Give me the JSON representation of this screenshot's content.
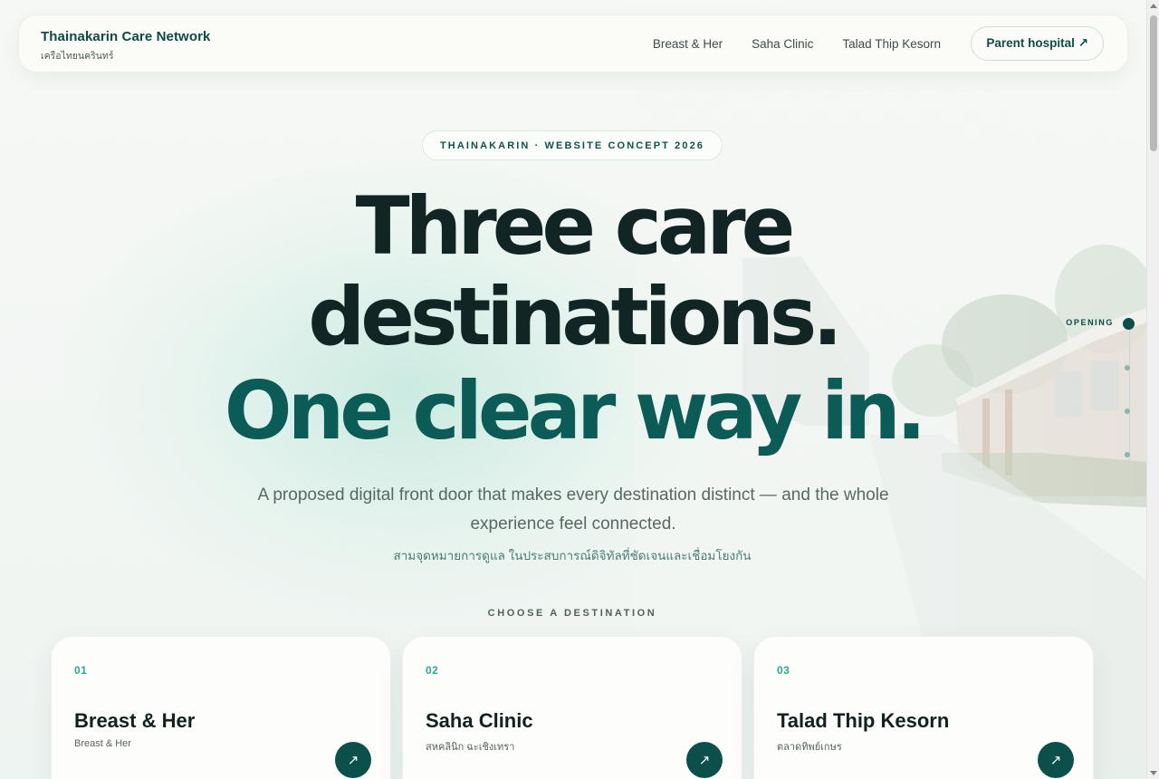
{
  "header": {
    "brand_name": "Thainakarin Care Network",
    "brand_sub": "เครือไทยนครินทร์",
    "nav": [
      {
        "label": "Breast & Her"
      },
      {
        "label": "Saha Clinic"
      },
      {
        "label": "Talad Thip Kesorn"
      }
    ],
    "parent_button": "Parent hospital ↗"
  },
  "hero": {
    "badge": "THAINAKARIN · WEBSITE CONCEPT 2026",
    "headline_line1": "Three care",
    "headline_line2": "destinations.",
    "headline_accent": "One clear way in.",
    "subtitle": "A proposed digital front door that makes every destination distinct — and the whole experience feel connected.",
    "subtitle_th": "สามจุดหมายการดูแล ในประสบการณ์ดิจิทัลที่ชัดเจนและเชื่อมโยงกัน",
    "choose_label": "CHOOSE A DESTINATION"
  },
  "cards": [
    {
      "num": "01",
      "title": "Breast & Her",
      "sub": "Breast & Her",
      "arrow": "↗"
    },
    {
      "num": "02",
      "title": "Saha Clinic",
      "sub": "สหคลินิก ฉะเชิงเทรา",
      "arrow": "↗"
    },
    {
      "num": "03",
      "title": "Talad Thip Kesorn",
      "sub": "ตลาดทิพย์เกษร",
      "arrow": "↗"
    }
  ],
  "progress": {
    "active_label": "OPENING",
    "sections": 4,
    "active_index": 0
  },
  "colors": {
    "brand": "#0c4a45",
    "accent": "#0b5b56",
    "headline": "#112624",
    "number_accent": "#2ca79a",
    "background": "#f4f7f4"
  }
}
